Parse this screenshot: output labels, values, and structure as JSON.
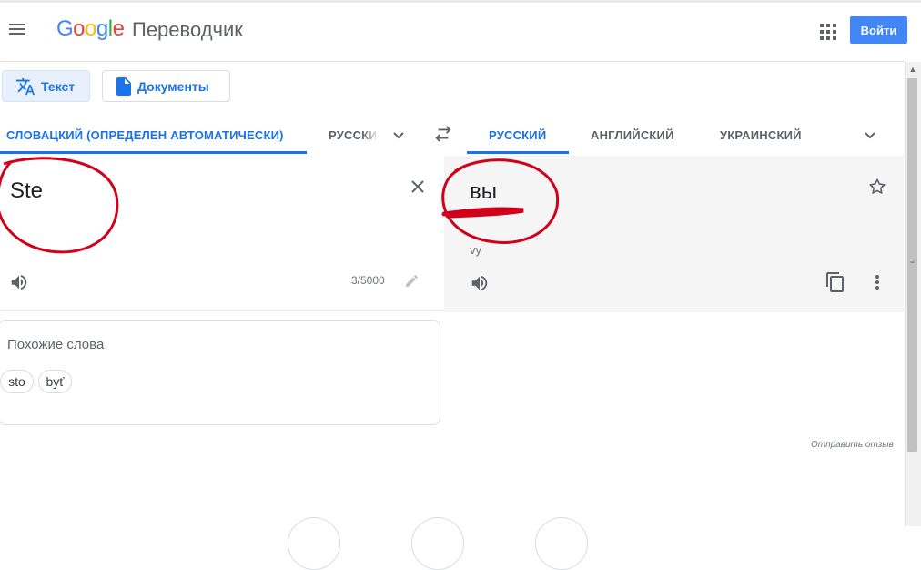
{
  "header": {
    "logo": {
      "letters": [
        {
          "char": "G",
          "color": "#4285f4"
        },
        {
          "char": "o",
          "color": "#ea4335"
        },
        {
          "char": "o",
          "color": "#fbbc05"
        },
        {
          "char": "g",
          "color": "#4285f4"
        },
        {
          "char": "l",
          "color": "#34a853"
        },
        {
          "char": "e",
          "color": "#ea4335"
        }
      ]
    },
    "product_name": "Переводчик",
    "menu_icon": "hamburger-menu-icon",
    "apps_icon": "apps-grid-icon",
    "signin_label": "Войти"
  },
  "modes": {
    "text_label": "Текст",
    "docs_label": "Документы",
    "text_icon": "translate-icon",
    "docs_icon": "document-icon"
  },
  "languages": {
    "source": [
      "СЛОВАЦКИЙ (ОПРЕДЕЛЕН АВТОМАТИЧЕСКИ)",
      "РУССКИЙ"
    ],
    "source_active_index": 0,
    "target": [
      "РУССКИЙ",
      "АНГЛИЙСКИЙ",
      "УКРАИНСКИЙ"
    ],
    "target_active_index": 0,
    "swap_icon": "swap-arrows-icon",
    "more_icon": "chevron-down-icon"
  },
  "source_panel": {
    "text": "Ste",
    "char_count": "3/5000",
    "clear_icon": "close-icon",
    "listen_icon": "speaker-icon",
    "edit_icon": "pencil-icon"
  },
  "target_panel": {
    "text": "вы",
    "transliteration": "vy",
    "star_icon": "star-icon",
    "listen_icon": "speaker-icon",
    "copy_icon": "copy-icon",
    "more_icon": "more-vert-icon"
  },
  "similar_words": {
    "title": "Похожие слова",
    "words": [
      "sto",
      "byť"
    ]
  },
  "feedback_label": "Отправить отзыв",
  "annotation_color": "#d0021b",
  "accent_color": "#1a73e8"
}
